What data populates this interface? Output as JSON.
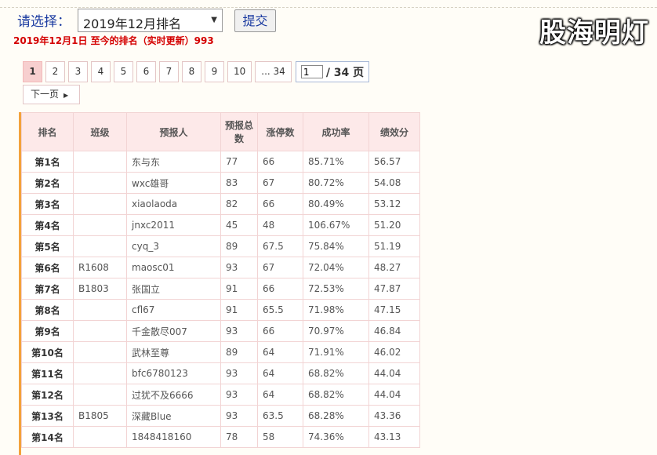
{
  "header": {
    "select_label": "请选择：",
    "selected_option": "2019年12月排名",
    "submit_label": "提交",
    "watermark": "股海明灯"
  },
  "status": "2019年12月1日 至今的排名（实时更新）993",
  "pagination": {
    "pages": [
      "1",
      "2",
      "3",
      "4",
      "5",
      "6",
      "7",
      "8",
      "9",
      "10",
      "... 34"
    ],
    "current": "1",
    "input_value": "1",
    "total": "/ 34 页",
    "next_label": "下一页"
  },
  "table": {
    "columns": [
      "排名",
      "班级",
      "预报人",
      "预报总数",
      "涨停数",
      "成功率",
      "绩效分"
    ],
    "rows": [
      [
        "第1名",
        "",
        "东与东",
        "77",
        "66",
        "85.71%",
        "56.57"
      ],
      [
        "第2名",
        "",
        "wxc雄哥",
        "83",
        "67",
        "80.72%",
        "54.08"
      ],
      [
        "第3名",
        "",
        "xiaolaoda",
        "82",
        "66",
        "80.49%",
        "53.12"
      ],
      [
        "第4名",
        "",
        "jnxc2011",
        "45",
        "48",
        "106.67%",
        "51.20"
      ],
      [
        "第5名",
        "",
        "cyq_3",
        "89",
        "67.5",
        "75.84%",
        "51.19"
      ],
      [
        "第6名",
        "R1608",
        "maosc01",
        "93",
        "67",
        "72.04%",
        "48.27"
      ],
      [
        "第7名",
        "B1803",
        "张国立",
        "91",
        "66",
        "72.53%",
        "47.87"
      ],
      [
        "第8名",
        "",
        "cfl67",
        "91",
        "65.5",
        "71.98%",
        "47.15"
      ],
      [
        "第9名",
        "",
        "千金散尽007",
        "93",
        "66",
        "70.97%",
        "46.84"
      ],
      [
        "第10名",
        "",
        "武林至尊",
        "89",
        "64",
        "71.91%",
        "46.02"
      ],
      [
        "第11名",
        "",
        "bfc6780123",
        "93",
        "64",
        "68.82%",
        "44.04"
      ],
      [
        "第12名",
        "",
        "过犹不及6666",
        "93",
        "64",
        "68.82%",
        "44.04"
      ],
      [
        "第13名",
        "B1805",
        "深藏Blue",
        "93",
        "63.5",
        "68.28%",
        "43.36"
      ],
      [
        "第14名",
        "",
        "1848418160",
        "78",
        "58",
        "74.36%",
        "43.13"
      ]
    ]
  },
  "colors": {
    "accent_bar": "#f3a23b",
    "status_red": "#d40000",
    "header_bg": "#fde9e9",
    "label_blue": "#1a3aa0"
  }
}
